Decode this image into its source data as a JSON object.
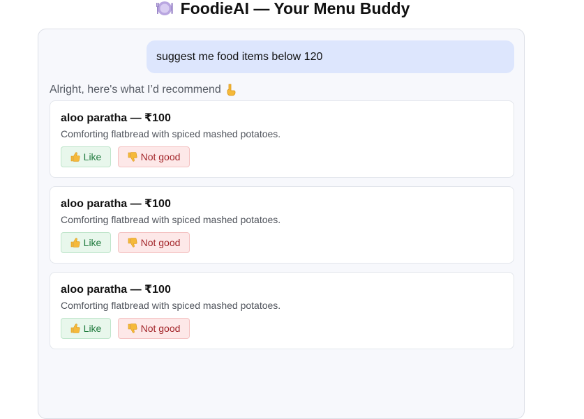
{
  "header": {
    "title": "FoodieAI — Your Menu Buddy",
    "icon": "plate-icon"
  },
  "chat": {
    "user_message": "suggest me food items below 120",
    "bot_intro": "Alright, here's what I’d recommend",
    "bot_intro_icon": "pointing-down-icon",
    "recommendations": [
      {
        "title": "aloo paratha — ₹100",
        "description": "Comforting flatbread with spiced mashed potatoes.",
        "like_label": "Like",
        "dislike_label": "Not good"
      },
      {
        "title": "aloo paratha — ₹100",
        "description": "Comforting flatbread with spiced mashed potatoes.",
        "like_label": "Like",
        "dislike_label": "Not good"
      },
      {
        "title": "aloo paratha — ₹100",
        "description": "Comforting flatbread with spiced mashed potatoes.",
        "like_label": "Like",
        "dislike_label": "Not good"
      }
    ]
  },
  "colors": {
    "user_bubble": "#dde6fd",
    "panel_background": "#f7f8fc",
    "like_text": "#1f7a3d",
    "dislike_text": "#a3262a"
  }
}
